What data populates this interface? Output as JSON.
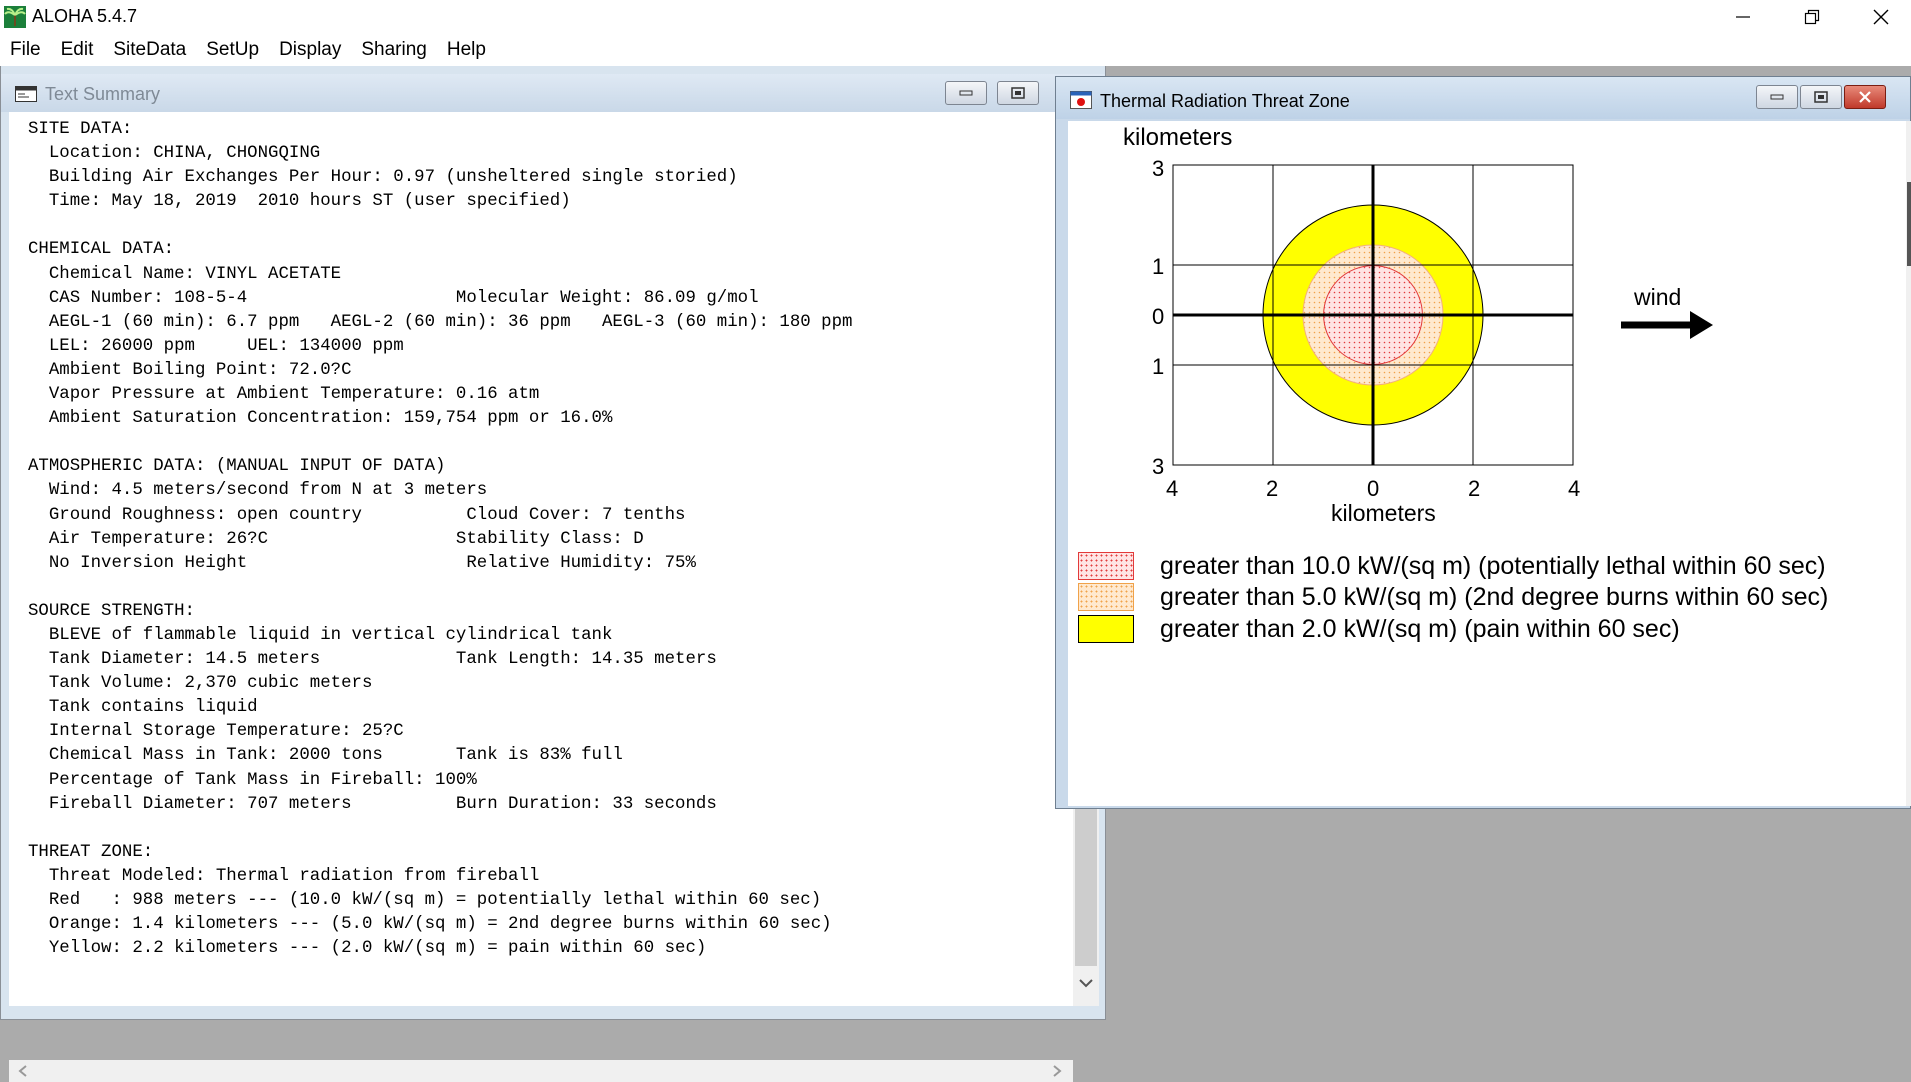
{
  "app": {
    "title": "ALOHA 5.4.7",
    "menu": [
      "File",
      "Edit",
      "SiteData",
      "SetUp",
      "Display",
      "Sharing",
      "Help"
    ]
  },
  "text_summary": {
    "title": "Text Summary",
    "lines": [
      "SITE DATA:",
      "  Location: CHINA, CHONGQING",
      "  Building Air Exchanges Per Hour: 0.97 (unsheltered single storied)",
      "  Time: May 18, 2019  2010 hours ST (user specified)",
      "",
      "CHEMICAL DATA:",
      "  Chemical Name: VINYL ACETATE",
      "  CAS Number: 108-5-4                    Molecular Weight: 86.09 g/mol",
      "  AEGL-1 (60 min): 6.7 ppm   AEGL-2 (60 min): 36 ppm   AEGL-3 (60 min): 180 ppm",
      "  LEL: 26000 ppm     UEL: 134000 ppm",
      "  Ambient Boiling Point: 72.0?C",
      "  Vapor Pressure at Ambient Temperature: 0.16 atm",
      "  Ambient Saturation Concentration: 159,754 ppm or 16.0%",
      "",
      "ATMOSPHERIC DATA: (MANUAL INPUT OF DATA)",
      "  Wind: 4.5 meters/second from N at 3 meters",
      "  Ground Roughness: open country          Cloud Cover: 7 tenths",
      "  Air Temperature: 26?C                  Stability Class: D",
      "  No Inversion Height                     Relative Humidity: 75%",
      "",
      "SOURCE STRENGTH:",
      "  BLEVE of flammable liquid in vertical cylindrical tank",
      "  Tank Diameter: 14.5 meters             Tank Length: 14.35 meters",
      "  Tank Volume: 2,370 cubic meters",
      "  Tank contains liquid",
      "  Internal Storage Temperature: 25?C",
      "  Chemical Mass in Tank: 2000 tons       Tank is 83% full",
      "  Percentage of Tank Mass in Fireball: 100%",
      "  Fireball Diameter: 707 meters          Burn Duration: 33 seconds",
      "",
      "THREAT ZONE:",
      "  Threat Modeled: Thermal radiation from fireball",
      "  Red   : 988 meters --- (10.0 kW/(sq m) = potentially lethal within 60 sec)",
      "  Orange: 1.4 kilometers --- (5.0 kW/(sq m) = 2nd degree burns within 60 sec)",
      "  Yellow: 2.2 kilometers --- (2.0 kW/(sq m) = pain within 60 sec)"
    ]
  },
  "threat_window": {
    "title": "Thermal Radiation Threat Zone",
    "y_unit": "kilometers",
    "x_unit": "kilometers",
    "y_tick_labels": [
      "3",
      "1",
      "0",
      "1",
      "3"
    ],
    "x_tick_labels": [
      "4",
      "2",
      "0",
      "2",
      "4"
    ],
    "wind_label": "wind",
    "zones": [
      {
        "color": "#ffff00",
        "radius_km": 2.2
      },
      {
        "color": "#ffe2c2",
        "radius_km": 1.4
      },
      {
        "color": "#ffd8d8",
        "radius_km": 0.988
      }
    ],
    "legend": [
      {
        "text": "greater than 10.0 kW/(sq m) (potentially lethal within 60 sec)",
        "swatch": "red-dots"
      },
      {
        "text": "greater than 5.0 kW/(sq m) (2nd degree burns within 60 sec)",
        "swatch": "orange-dots"
      },
      {
        "text": "greater than 2.0 kW/(sq m) (pain within 60 sec)",
        "swatch": "yellow"
      }
    ]
  }
}
